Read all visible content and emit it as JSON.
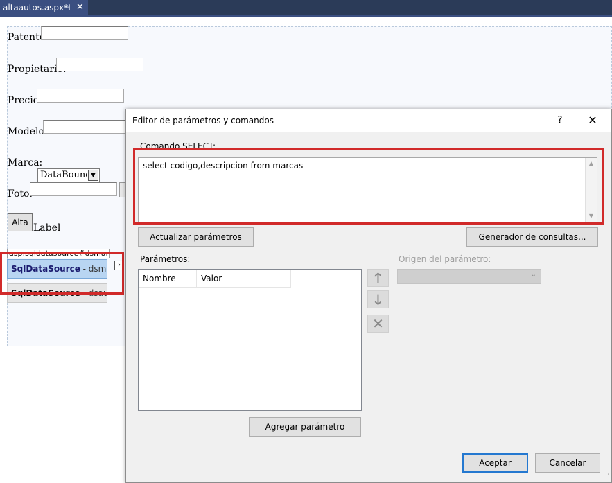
{
  "tab": {
    "title": "altaautos.aspx*",
    "pin_icon": "pin-icon",
    "close_icon": "close-icon"
  },
  "form": {
    "patente_label": "Patente:",
    "propietario_label": "Propietario:",
    "precio_label": "Precio:",
    "modelo_label": "Modelo:",
    "marca_label": "Marca:",
    "marca_select_value": "DataBound",
    "foto_label": "Foto:",
    "alta_button": "Alta",
    "result_label": "Label",
    "ds_header": "asp:sqldatasource#dsmarcas",
    "ds1_name": "SqlDataSource",
    "ds1_rest": " - dsmarcas",
    "ds2_name": "SqlDataSource",
    "ds2_rest": " - dsautos",
    "smart_tag": "›"
  },
  "dialog": {
    "title": "Editor de parámetros y comandos",
    "help": "?",
    "close": "✕",
    "command_label": "Comando SELECT:",
    "sql": "select codigo,descripcion from marcas",
    "refresh_button": "Actualizar parámetros",
    "query_builder_button": "Generador de consultas...",
    "params_label": "Parámetros:",
    "col_name": "Nombre",
    "col_value": "Valor",
    "origin_label": "Origen del parámetro:",
    "move_up": "🡑",
    "move_down": "🡓",
    "remove": "✕",
    "add_param_button": "Agregar parámetro",
    "ok_button": "Aceptar",
    "cancel_button": "Cancelar"
  },
  "colors": {
    "highlight": "#d12a2a",
    "tab_bar": "#2b3b58",
    "tab_active": "#3b4f81",
    "selection": "#b8d5f2"
  }
}
